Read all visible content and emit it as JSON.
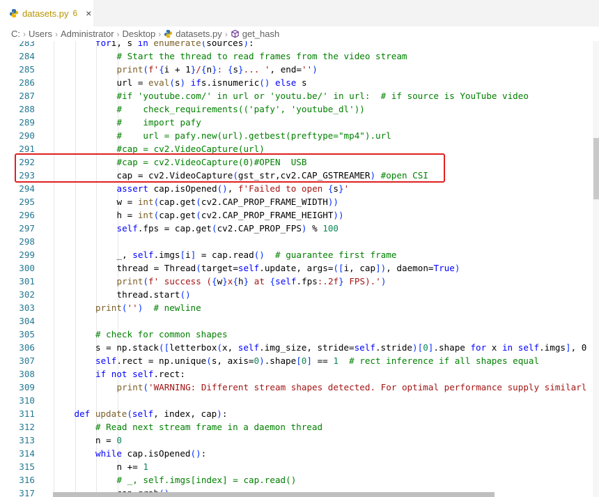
{
  "tab": {
    "filename": "datasets.py",
    "problem_count": "6",
    "close_glyph": "×"
  },
  "breadcrumb": [
    "C:",
    "Users",
    "Administrator",
    "Desktop",
    "datasets.py",
    "get_hash"
  ],
  "theme": {
    "highlight_box": "#e02020",
    "line_number": "#237893"
  },
  "highlight": {
    "start_line": "292",
    "end_line": "293"
  },
  "code_lines": [
    {
      "n": "283",
      "indent": 2,
      "tokens": [
        [
          "kw",
          "for"
        ],
        [
          "",
          "i, s "
        ],
        [
          "kw",
          "in"
        ],
        [
          "fn",
          " enumerate"
        ],
        [
          "br",
          "("
        ],
        [
          "",
          "sources"
        ],
        [
          "br",
          ")"
        ],
        [
          "",
          ":"
        ]
      ]
    },
    {
      "n": "284",
      "indent": 3,
      "tokens": [
        [
          "com",
          "# Start the thread to read frames from the video stream"
        ]
      ]
    },
    {
      "n": "285",
      "indent": 3,
      "tokens": [
        [
          "fn",
          "print"
        ],
        [
          "br",
          "("
        ],
        [
          "str",
          "f'"
        ],
        [
          "br",
          "{"
        ],
        [
          "",
          "i + 1"
        ],
        [
          "br",
          "}"
        ],
        [
          "str",
          "/"
        ],
        [
          "br",
          "{"
        ],
        [
          "",
          "n"
        ],
        [
          "br",
          "}"
        ],
        [
          "str",
          ": "
        ],
        [
          "br",
          "{"
        ],
        [
          "",
          "s"
        ],
        [
          "br",
          "}"
        ],
        [
          "str",
          "... '"
        ],
        [
          "",
          ", end="
        ],
        [
          "str",
          "''"
        ],
        [
          "br",
          ")"
        ]
      ]
    },
    {
      "n": "286",
      "indent": 3,
      "tokens": [
        [
          "",
          "url = "
        ],
        [
          "fn",
          "eval"
        ],
        [
          "br",
          "("
        ],
        [
          "",
          "s"
        ],
        [
          "br",
          ")"
        ],
        [
          "kw",
          " if"
        ],
        [
          "",
          ""
        ],
        [
          "",
          "s.isnumeric"
        ],
        [
          "br",
          "()"
        ],
        [
          "kw",
          " else"
        ],
        [
          "",
          " s"
        ]
      ]
    },
    {
      "n": "287",
      "indent": 3,
      "tokens": [
        [
          "com",
          "#if 'youtube.com/' in url or 'youtu.be/' in url:  # if source is YouTube video"
        ]
      ]
    },
    {
      "n": "288",
      "indent": 3,
      "tokens": [
        [
          "com",
          "#    check_requirements(('pafy', 'youtube_dl'))"
        ]
      ]
    },
    {
      "n": "289",
      "indent": 3,
      "tokens": [
        [
          "com",
          "#    import pafy"
        ]
      ]
    },
    {
      "n": "290",
      "indent": 3,
      "tokens": [
        [
          "com",
          "#    url = pafy.new(url).getbest(preftype=\"mp4\").url"
        ]
      ]
    },
    {
      "n": "291",
      "indent": 3,
      "tokens": [
        [
          "com",
          "#cap = cv2.VideoCapture(url)"
        ]
      ]
    },
    {
      "n": "292",
      "indent": 3,
      "tokens": [
        [
          "com",
          "#cap = cv2.VideoCapture(0)#OPEN  USB"
        ]
      ]
    },
    {
      "n": "293",
      "indent": 3,
      "tokens": [
        [
          "",
          "cap = cv2.VideoCapture"
        ],
        [
          "br",
          "("
        ],
        [
          "",
          "gst_str,cv2.CAP_GSTREAMER"
        ],
        [
          "br",
          ")"
        ],
        [
          "com",
          " #open CSI"
        ]
      ]
    },
    {
      "n": "294",
      "indent": 3,
      "tokens": [
        [
          "kw",
          "assert"
        ],
        [
          "",
          " cap.isOpened"
        ],
        [
          "br",
          "()"
        ],
        [
          "",
          ", "
        ],
        [
          "str",
          "f'Failed to open "
        ],
        [
          "br",
          "{"
        ],
        [
          "",
          "s"
        ],
        [
          "br",
          "}"
        ],
        [
          "str",
          "'"
        ]
      ]
    },
    {
      "n": "295",
      "indent": 3,
      "tokens": [
        [
          "",
          "w = "
        ],
        [
          "fn",
          "int"
        ],
        [
          "br",
          "("
        ],
        [
          "",
          "cap.get"
        ],
        [
          "br",
          "("
        ],
        [
          "",
          "cv2.CAP_PROP_FRAME_WIDTH"
        ],
        [
          "br",
          "))"
        ]
      ]
    },
    {
      "n": "296",
      "indent": 3,
      "tokens": [
        [
          "",
          "h = "
        ],
        [
          "fn",
          "int"
        ],
        [
          "br",
          "("
        ],
        [
          "",
          "cap.get"
        ],
        [
          "br",
          "("
        ],
        [
          "",
          "cv2.CAP_PROP_FRAME_HEIGHT"
        ],
        [
          "br",
          "))"
        ]
      ]
    },
    {
      "n": "297",
      "indent": 3,
      "tokens": [
        [
          "self",
          "self"
        ],
        [
          "",
          ".fps = cap.get"
        ],
        [
          "br",
          "("
        ],
        [
          "",
          "cv2.CAP_PROP_FPS"
        ],
        [
          "br",
          ")"
        ],
        [
          "",
          " % "
        ],
        [
          "num",
          "100"
        ]
      ]
    },
    {
      "n": "298",
      "indent": 0,
      "tokens": []
    },
    {
      "n": "299",
      "indent": 3,
      "tokens": [
        [
          "",
          "_, "
        ],
        [
          "self",
          "self"
        ],
        [
          "",
          ".imgs"
        ],
        [
          "br",
          "["
        ],
        [
          "",
          "i"
        ],
        [
          "br",
          "]"
        ],
        [
          "",
          " = cap.read"
        ],
        [
          "br",
          "()"
        ],
        [
          "com",
          "  # guarantee first frame"
        ]
      ]
    },
    {
      "n": "300",
      "indent": 3,
      "tokens": [
        [
          "",
          "thread = Thread"
        ],
        [
          "br",
          "("
        ],
        [
          "",
          "target="
        ],
        [
          "self",
          "self"
        ],
        [
          "",
          ".update, args="
        ],
        [
          "br",
          "(["
        ],
        [
          "",
          "i, cap"
        ],
        [
          "br",
          "])"
        ],
        [
          "",
          ", daemon="
        ],
        [
          "kw",
          "True"
        ],
        [
          "br",
          ")"
        ]
      ]
    },
    {
      "n": "301",
      "indent": 3,
      "tokens": [
        [
          "fn",
          "print"
        ],
        [
          "br",
          "("
        ],
        [
          "str",
          "f' success ("
        ],
        [
          "br",
          "{"
        ],
        [
          "",
          "w"
        ],
        [
          "br",
          "}"
        ],
        [
          "str",
          "x"
        ],
        [
          "br",
          "{"
        ],
        [
          "",
          "h"
        ],
        [
          "br",
          "}"
        ],
        [
          "str",
          " at "
        ],
        [
          "br",
          "{"
        ],
        [
          "self",
          "self"
        ],
        [
          "",
          ".fps"
        ],
        [
          "str",
          ":.2f"
        ],
        [
          "br",
          "}"
        ],
        [
          "str",
          " FPS).'"
        ],
        [
          "br",
          ")"
        ]
      ]
    },
    {
      "n": "302",
      "indent": 3,
      "tokens": [
        [
          "",
          "thread.start"
        ],
        [
          "br",
          "()"
        ]
      ]
    },
    {
      "n": "303",
      "indent": 2,
      "tokens": [
        [
          "fn",
          "print"
        ],
        [
          "br",
          "("
        ],
        [
          "str",
          "''"
        ],
        [
          "br",
          ")"
        ],
        [
          "com",
          "  # newline"
        ]
      ]
    },
    {
      "n": "304",
      "indent": 0,
      "tokens": []
    },
    {
      "n": "305",
      "indent": 2,
      "tokens": [
        [
          "com",
          "# check for common shapes"
        ]
      ]
    },
    {
      "n": "306",
      "indent": 2,
      "tokens": [
        [
          "",
          "s = np.stack"
        ],
        [
          "br",
          "(["
        ],
        [
          "",
          "letterbox"
        ],
        [
          "br",
          "("
        ],
        [
          "",
          "x, "
        ],
        [
          "self",
          "self"
        ],
        [
          "",
          ".img_size, stride="
        ],
        [
          "self",
          "self"
        ],
        [
          "",
          ".stride"
        ],
        [
          "br",
          ")"
        ],
        [
          "br",
          "["
        ],
        [
          "num",
          "0"
        ],
        [
          "br",
          "]"
        ],
        [
          "",
          ".shape "
        ],
        [
          "kw",
          "for"
        ],
        [
          "",
          " x "
        ],
        [
          "kw",
          "in"
        ],
        [
          "",
          " "
        ],
        [
          "self",
          "self"
        ],
        [
          "",
          ".imgs"
        ],
        [
          "br",
          "]"
        ],
        [
          "",
          ", 0"
        ]
      ]
    },
    {
      "n": "307",
      "indent": 2,
      "tokens": [
        [
          "self",
          "self"
        ],
        [
          "",
          ".rect = np.unique"
        ],
        [
          "br",
          "("
        ],
        [
          "",
          "s, axis="
        ],
        [
          "num",
          "0"
        ],
        [
          "br",
          ")"
        ],
        [
          "",
          ".shape"
        ],
        [
          "br",
          "["
        ],
        [
          "num",
          "0"
        ],
        [
          "br",
          "]"
        ],
        [
          "",
          " == "
        ],
        [
          "num",
          "1"
        ],
        [
          "com",
          "  # rect inference if all shapes equal"
        ]
      ]
    },
    {
      "n": "308",
      "indent": 2,
      "tokens": [
        [
          "kw",
          "if"
        ],
        [
          "kw",
          " not"
        ],
        [
          "",
          " "
        ],
        [
          "self",
          "self"
        ],
        [
          "",
          ".rect:"
        ]
      ]
    },
    {
      "n": "309",
      "indent": 3,
      "tokens": [
        [
          "fn",
          "print"
        ],
        [
          "br",
          "("
        ],
        [
          "str",
          "'WARNING: Different stream shapes detected. For optimal performance supply similarl"
        ]
      ]
    },
    {
      "n": "310",
      "indent": 0,
      "tokens": []
    },
    {
      "n": "311",
      "indent": 1,
      "tokens": [
        [
          "kw",
          "def"
        ],
        [
          "fn",
          " update"
        ],
        [
          "br",
          "("
        ],
        [
          "self",
          "self"
        ],
        [
          "",
          ", index, cap"
        ],
        [
          "br",
          ")"
        ],
        [
          "",
          ":"
        ]
      ]
    },
    {
      "n": "312",
      "indent": 2,
      "tokens": [
        [
          "com",
          "# Read next stream frame in a daemon thread"
        ]
      ]
    },
    {
      "n": "313",
      "indent": 2,
      "tokens": [
        [
          "",
          "n = "
        ],
        [
          "num",
          "0"
        ]
      ]
    },
    {
      "n": "314",
      "indent": 2,
      "tokens": [
        [
          "kw",
          "while"
        ],
        [
          "",
          " cap.isOpened"
        ],
        [
          "br",
          "()"
        ],
        [
          "",
          ":"
        ]
      ]
    },
    {
      "n": "315",
      "indent": 3,
      "tokens": [
        [
          "",
          "n += "
        ],
        [
          "num",
          "1"
        ]
      ]
    },
    {
      "n": "316",
      "indent": 3,
      "tokens": [
        [
          "com",
          "# _, self.imgs[index] = cap.read()"
        ]
      ]
    },
    {
      "n": "317",
      "indent": 3,
      "tokens": [
        [
          "",
          "cap.grab"
        ],
        [
          "br",
          "()"
        ]
      ]
    }
  ]
}
